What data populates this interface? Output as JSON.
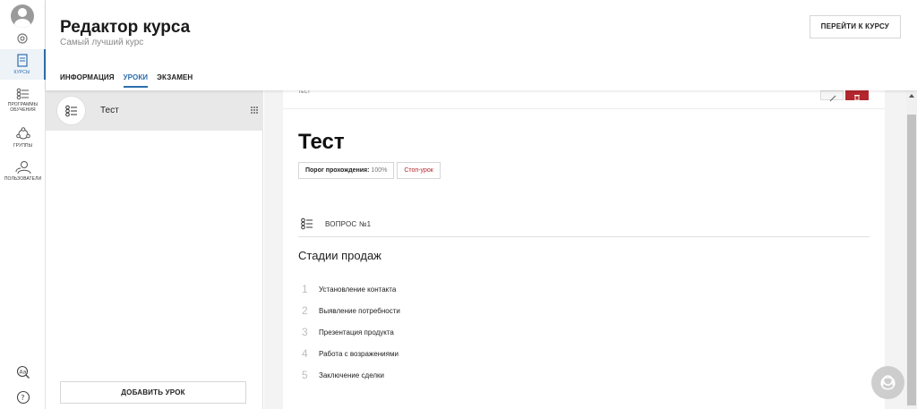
{
  "header": {
    "title": "Редактор курса",
    "subtitle": "Самый лучший курс",
    "goto_button": "ПЕРЕЙТИ К КУРСУ",
    "tabs": [
      {
        "label": "ИНФОРМАЦИЯ",
        "active": false
      },
      {
        "label": "УРОКИ",
        "active": true
      },
      {
        "label": "ЭКЗАМЕН",
        "active": false
      }
    ]
  },
  "sidebar": {
    "items": [
      {
        "label": "КУРСЫ",
        "icon": "courses-icon",
        "active": true
      },
      {
        "label": "ПРОГРАММЫ ОБУЧЕНИЯ",
        "icon": "programs-icon",
        "active": false
      },
      {
        "label": "ГРУППЫ",
        "icon": "groups-icon",
        "active": false
      },
      {
        "label": "ПОЛЬЗОВАТЕЛИ",
        "icon": "users-icon",
        "active": false
      }
    ]
  },
  "lessons": {
    "items": [
      {
        "name": "Тест",
        "icon": "checklist-icon"
      }
    ],
    "add_button": "ДОБАВИТЬ УРОК"
  },
  "lesson": {
    "header_label": "ТЕСТ",
    "title": "Тест",
    "threshold_label": "Порог прохождения:",
    "threshold_value": "100%",
    "stop_label": "Стоп-урок",
    "question": {
      "label": "ВОПРОС №1",
      "text": "Стадии продаж",
      "answers": [
        {
          "num": "1",
          "text": "Установление контакта"
        },
        {
          "num": "2",
          "text": "Выявление потребности"
        },
        {
          "num": "3",
          "text": "Презентация продукта"
        },
        {
          "num": "4",
          "text": "Работа с возражениями"
        },
        {
          "num": "5",
          "text": "Заключение сделки"
        }
      ]
    }
  },
  "colors": {
    "accent": "#2d6eab",
    "danger": "#b3262d",
    "panel_bg": "#f3f3f3",
    "selected_bg": "#e8e8e8"
  }
}
